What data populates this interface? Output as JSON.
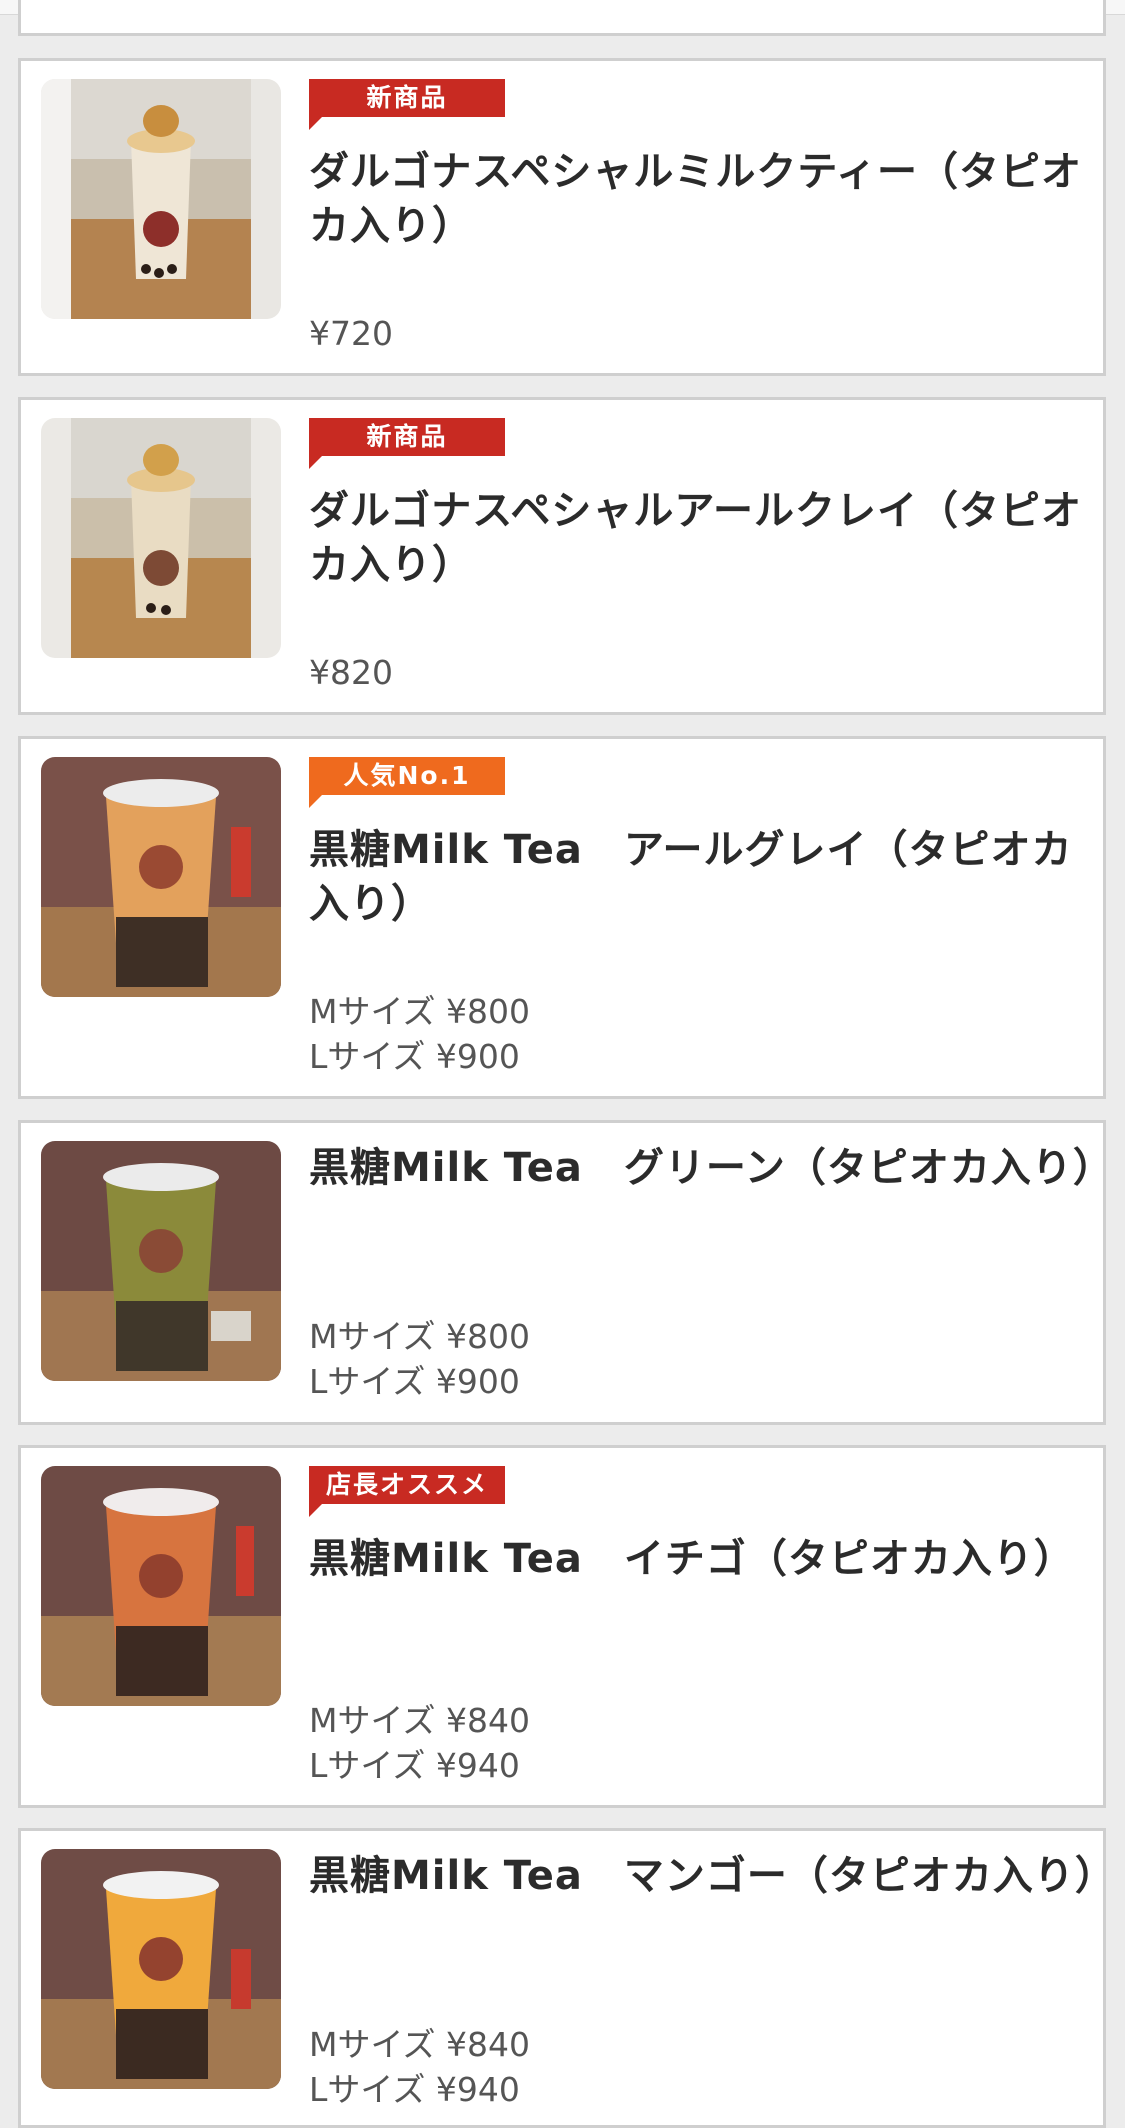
{
  "currency_symbol": "¥",
  "colors": {
    "badge_new": "#c82a22",
    "badge_popular": "#ef6a1e",
    "badge_manager": "#c82a22",
    "title": "#2b2b2b",
    "price": "#555555"
  },
  "products": [
    {
      "badge": "新商品",
      "badge_color": "red",
      "title": "ダルゴナスペシャルミルクティー（タピオカ入り）",
      "prices": [
        "¥720"
      ],
      "image": "dalgona-milk-tea-photo"
    },
    {
      "badge": "新商品",
      "badge_color": "red",
      "title": "ダルゴナスペシャルアールクレイ（タピオカ入り）",
      "prices": [
        "¥820"
      ],
      "image": "dalgona-earl-grey-photo"
    },
    {
      "badge": "人気No.1",
      "badge_color": "orange",
      "title": "黒糖Milk Tea　アールグレイ（タピオカ入り）",
      "prices": [
        "Mサイズ ¥800",
        "Lサイズ ¥900"
      ],
      "image": "brown-sugar-earl-grey-photo"
    },
    {
      "badge": "",
      "badge_color": "",
      "title": "黒糖Milk Tea　グリーン（タピオカ入り）",
      "prices": [
        "Mサイズ ¥800",
        "Lサイズ ¥900"
      ],
      "image": "brown-sugar-green-photo"
    },
    {
      "badge": "店長オススメ",
      "badge_color": "red",
      "title": "黒糖Milk Tea　イチゴ（タピオカ入り）",
      "prices": [
        "Mサイズ ¥840",
        "Lサイズ ¥940"
      ],
      "image": "brown-sugar-strawberry-photo"
    },
    {
      "badge": "",
      "badge_color": "",
      "title": "黒糖Milk Tea　マンゴー（タピオカ入り）",
      "prices": [
        "Mサイズ ¥840",
        "Lサイズ ¥940"
      ],
      "image": "brown-sugar-mango-photo"
    }
  ]
}
